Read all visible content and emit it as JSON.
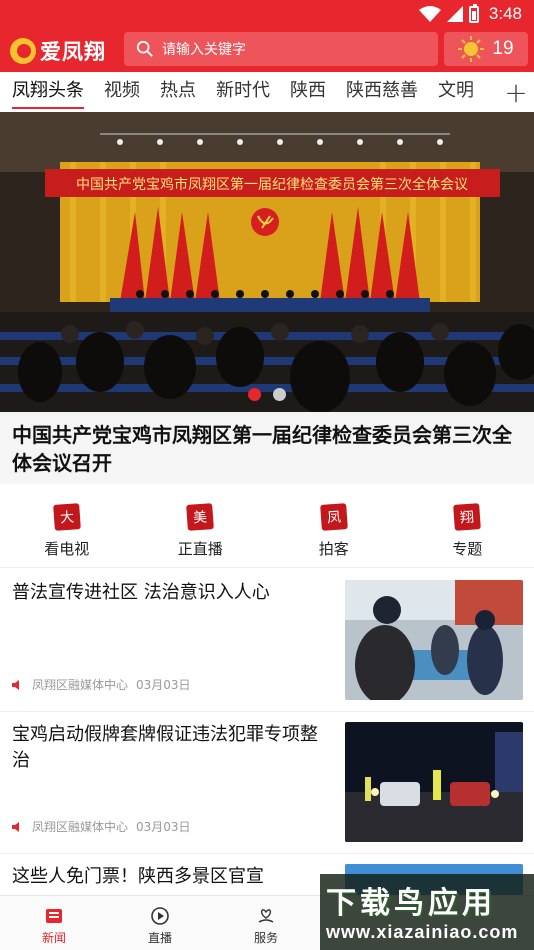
{
  "status": {
    "time": "3:48"
  },
  "header": {
    "app_name": "爱凤翔",
    "search_placeholder": "请输入关键字",
    "temperature": "19"
  },
  "tabs": [
    {
      "label": "凤翔头条",
      "active": true
    },
    {
      "label": "视频"
    },
    {
      "label": "热点"
    },
    {
      "label": "新时代"
    },
    {
      "label": "陕西"
    },
    {
      "label": "陕西慈善"
    },
    {
      "label": "文明"
    }
  ],
  "banner": {
    "banner_text": "中国共产党宝鸡市凤翔区第一届纪律检查委员会第三次全体会议",
    "headline": "中国共产党宝鸡市凤翔区第一届纪律检查委员会第三次全体会议召开",
    "slide_count": 2,
    "active_slide": 1
  },
  "quick_nav": [
    {
      "seal": "大",
      "label": "看电视"
    },
    {
      "seal": "美",
      "label": "正直播"
    },
    {
      "seal": "凤",
      "label": "拍客"
    },
    {
      "seal": "翔",
      "label": "专题"
    }
  ],
  "news": [
    {
      "title": "普法宣传进社区 法治意识入人心",
      "source": "凤翔区融媒体中心",
      "date": "03月03日"
    },
    {
      "title": "宝鸡启动假牌套牌假证违法犯罪专项整治",
      "source": "凤翔区融媒体中心",
      "date": "03月03日"
    },
    {
      "title": "这些人免门票！陕西多景区官宣"
    }
  ],
  "bottom_nav": [
    {
      "label": "新闻",
      "icon": "news-icon",
      "active": true
    },
    {
      "label": "直播",
      "icon": "play-icon"
    },
    {
      "label": "服务",
      "icon": "heart-hand-icon"
    }
  ],
  "watermark": {
    "title": "下载鸟应用",
    "url": "www.xiazainiao.com"
  },
  "colors": {
    "brand_red": "#e8262d",
    "seal_red": "#c3171c"
  }
}
